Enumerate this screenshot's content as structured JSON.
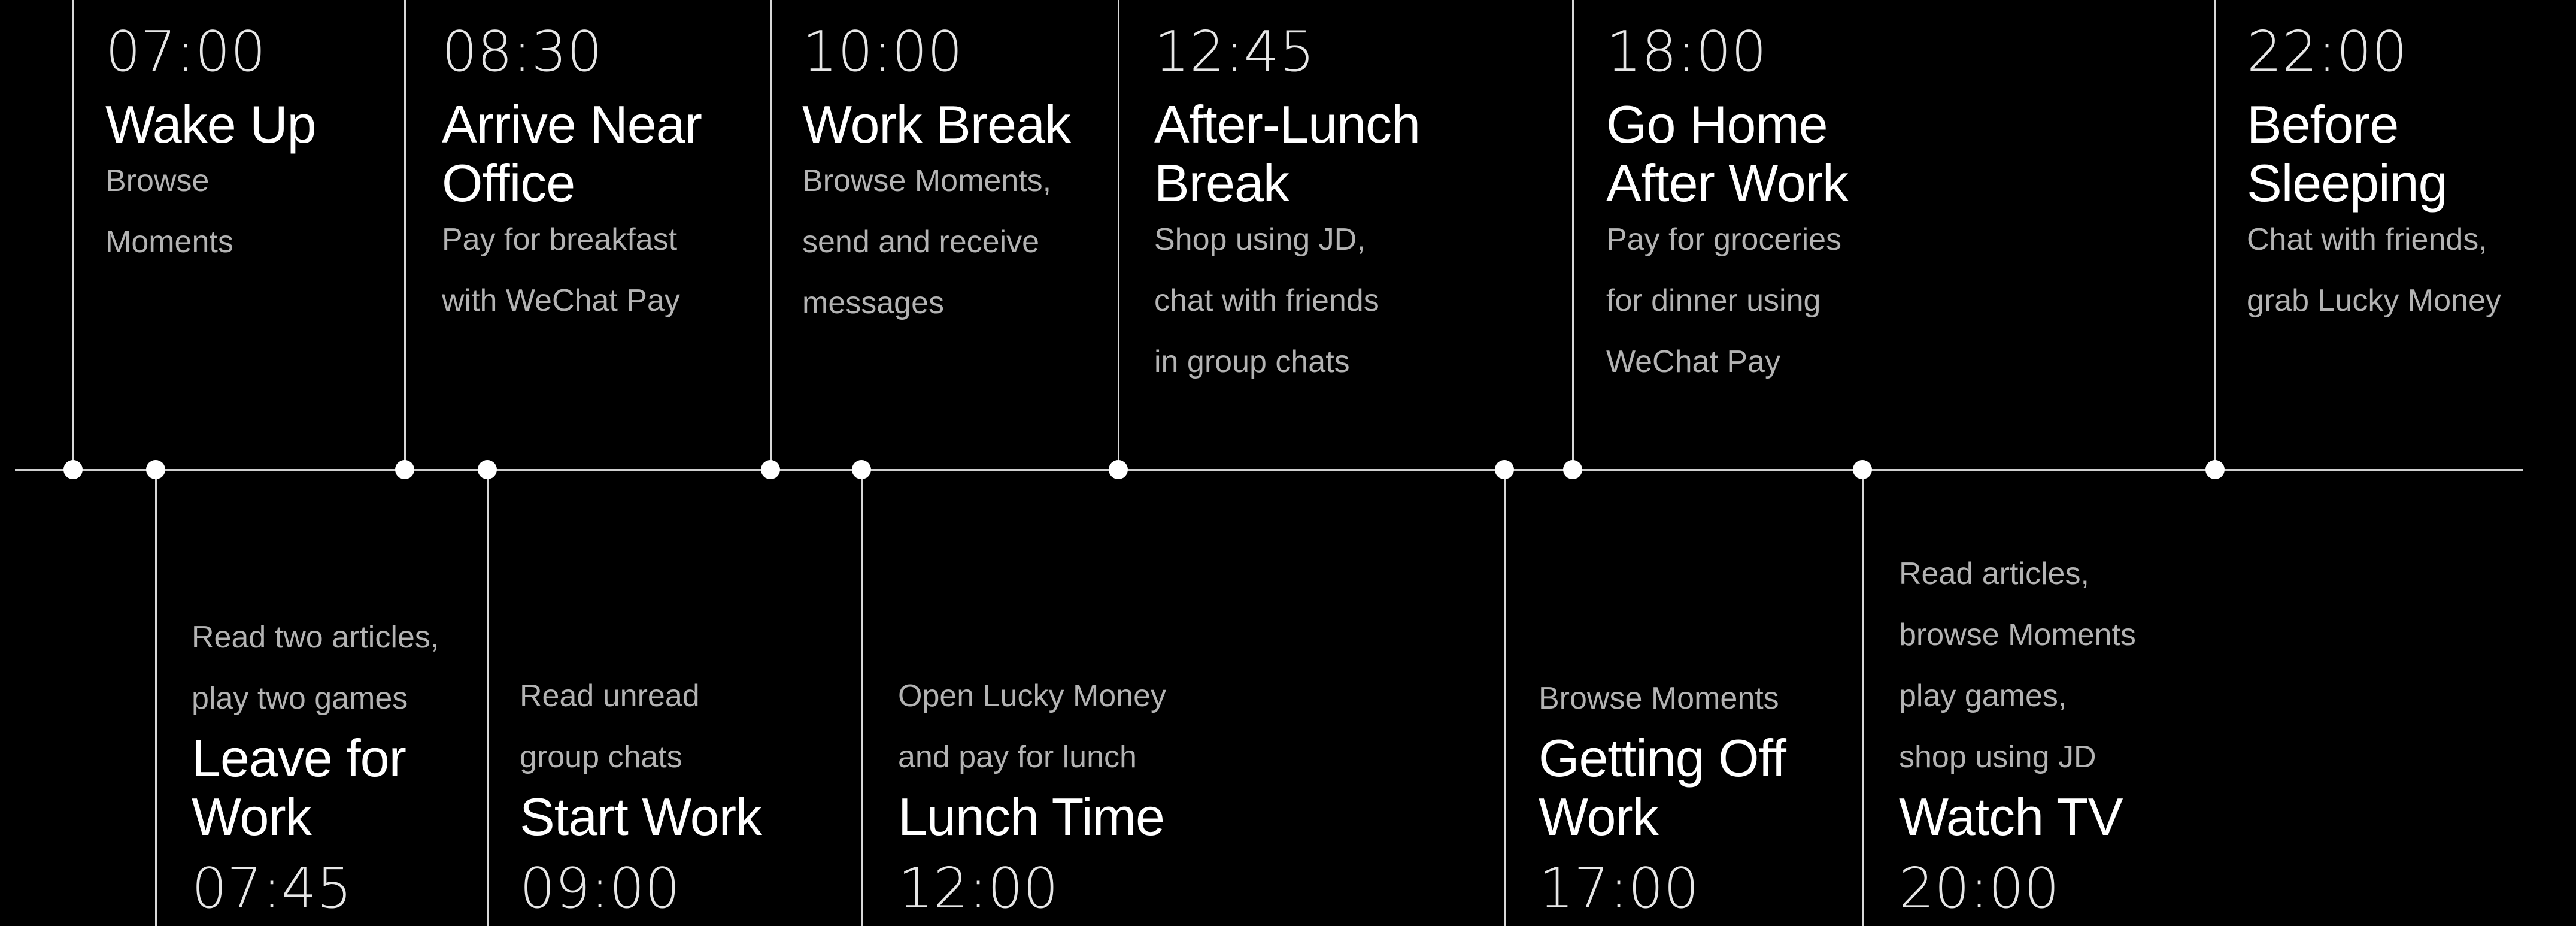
{
  "events_top": [
    {
      "time": "07:00",
      "title_lines": [
        "Wake Up"
      ],
      "desc_lines": [
        "Browse",
        "Moments"
      ]
    },
    {
      "time": "08:30",
      "title_lines": [
        "Arrive Near",
        "Office"
      ],
      "desc_lines": [
        "Pay for breakfast",
        "with WeChat Pay"
      ]
    },
    {
      "time": "10:00",
      "title_lines": [
        "Work Break"
      ],
      "desc_lines": [
        "Browse Moments,",
        "send and receive",
        "messages"
      ]
    },
    {
      "time": "12:45",
      "title_lines": [
        "After-Lunch",
        "Break"
      ],
      "desc_lines": [
        "Shop using JD,",
        "chat with friends",
        "in group chats"
      ]
    },
    {
      "time": "18:00",
      "title_lines": [
        "Go Home",
        "After Work"
      ],
      "desc_lines": [
        "Pay for groceries",
        "for dinner using",
        "WeChat Pay"
      ]
    },
    {
      "time": "22:00",
      "title_lines": [
        "Before",
        "Sleeping"
      ],
      "desc_lines": [
        "Chat with friends,",
        "grab Lucky Money"
      ]
    }
  ],
  "events_bottom": [
    {
      "time": "07:45",
      "title_lines": [
        "Leave for",
        "Work"
      ],
      "desc_lines": [
        "Read two articles,",
        "play two games"
      ]
    },
    {
      "time": "09:00",
      "title_lines": [
        "Start Work"
      ],
      "desc_lines": [
        "Read unread",
        "group chats"
      ]
    },
    {
      "time": "12:00",
      "title_lines": [
        "Lunch Time"
      ],
      "desc_lines": [
        "Open Lucky Money",
        "and pay for lunch"
      ]
    },
    {
      "time": "17:00",
      "title_lines": [
        "Getting Off",
        "Work"
      ],
      "desc_lines": [
        "Browse Moments"
      ]
    },
    {
      "time": "20:00",
      "title_lines": [
        "Watch TV"
      ],
      "desc_lines": [
        "Read articles,",
        "browse Moments",
        "play games,",
        "shop using JD"
      ]
    }
  ]
}
